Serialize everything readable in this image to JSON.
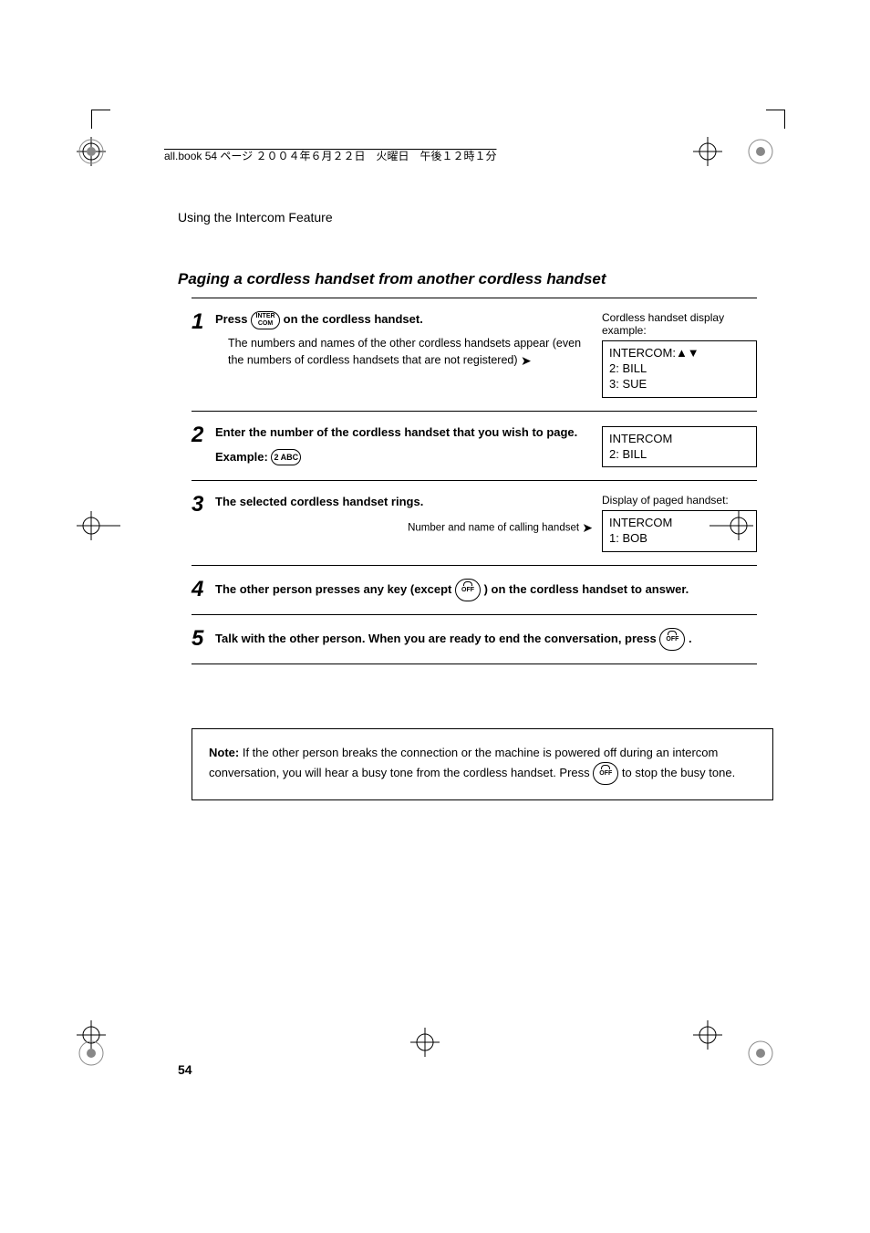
{
  "header_line": "all.book  54 ページ  ２００４年６月２２日　火曜日　午後１２時１分",
  "section_title": "Using the Intercom Feature",
  "subheading": "Paging a cordless handset from another cordless handset",
  "steps": {
    "s1": {
      "num": "1",
      "press": "Press",
      "key": "INTER\nCOM",
      "after_key": " on the cordless handset.",
      "sub": "The numbers and names of the other cordless handsets appear (even the numbers of cordless handsets that are not registered)",
      "caption": "Cordless handset display example:",
      "display_l1": "INTERCOM:▲▼",
      "display_l2": "2: BILL",
      "display_l3": "3: SUE"
    },
    "s2": {
      "num": "2",
      "line1": "Enter the number of the cordless handset that you wish to page.",
      "example_label": "Example:",
      "example_key": "2 ABC",
      "display_l1": "INTERCOM",
      "display_l2": "2: BILL"
    },
    "s3": {
      "num": "3",
      "line1": "The selected cordless handset rings.",
      "right_small": "Number and name of calling handset",
      "caption": "Display of paged handset:",
      "display_l1": "INTERCOM",
      "display_l2": "1: BOB"
    },
    "s4": {
      "num": "4",
      "before_key": "The other person presses any key (except ",
      "key": "OFF",
      "after_key": " ) on the cordless handset to answer."
    },
    "s5": {
      "num": "5",
      "before_key": "Talk with the other person. When you are ready to end the conversation, press ",
      "key": "OFF",
      "after_key": " ."
    }
  },
  "note": {
    "bold": "Note:",
    "text1": " If the other person breaks the connection or the machine is powered off during an intercom conversation, you will hear a busy tone from the cordless handset. Press ",
    "key": "OFF",
    "text2": " to stop the busy tone."
  },
  "page_num": "54"
}
